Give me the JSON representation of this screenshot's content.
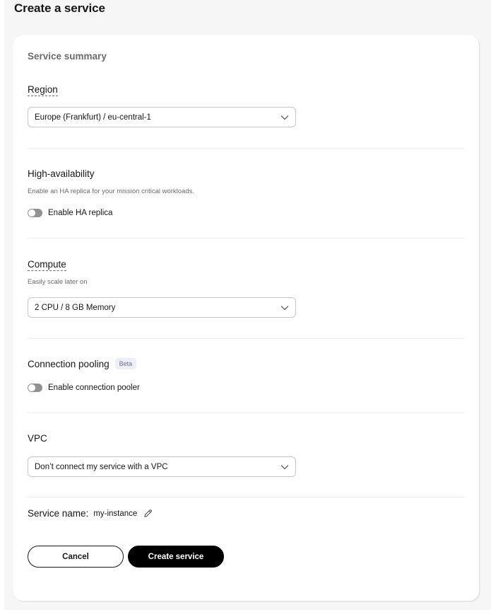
{
  "page": {
    "title": "Create a service"
  },
  "card": {
    "summary_title": "Service summary"
  },
  "region": {
    "label": "Region",
    "selected": "Europe (Frankfurt) / eu-central-1"
  },
  "high_availability": {
    "label": "High-availability",
    "helper": "Enable an HA replica for your mission critical workloads.",
    "toggle_label": "Enable HA replica",
    "enabled": false
  },
  "compute": {
    "label": "Compute",
    "helper": "Easily scale later on",
    "selected": "2 CPU / 8 GB Memory"
  },
  "connection_pooling": {
    "label": "Connection pooling",
    "badge": "Beta",
    "toggle_label": "Enable connection pooler",
    "enabled": false
  },
  "vpc": {
    "label": "VPC",
    "selected": "Don’t connect my service with a VPC"
  },
  "service_name": {
    "label": "Service name:",
    "value": "my-instance",
    "edit_icon": "pencil-icon"
  },
  "actions": {
    "cancel_label": "Cancel",
    "create_label": "Create service"
  },
  "colors": {
    "background": "#f6f6f6",
    "card": "#ffffff",
    "primary_button": "#000000",
    "badge_bg": "#eceffa",
    "muted_text": "#6b6b6b"
  }
}
